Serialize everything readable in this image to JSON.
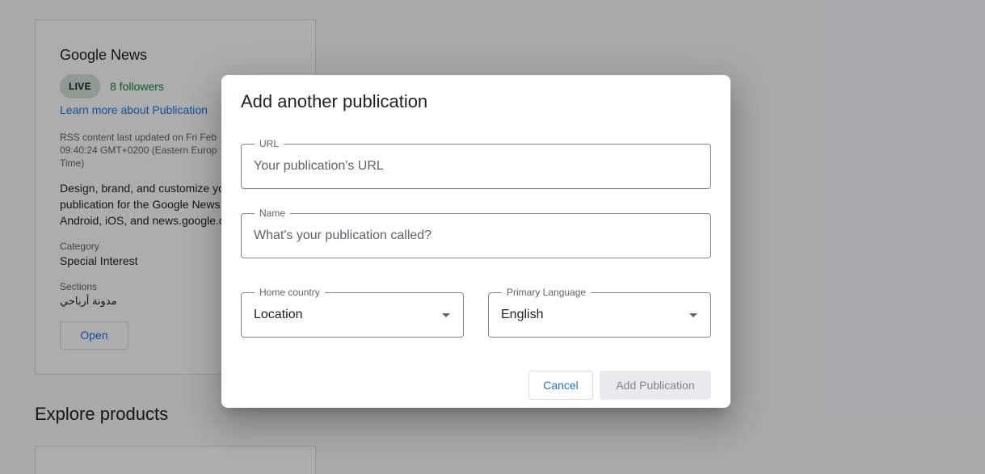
{
  "background": {
    "card": {
      "title": "Google News",
      "status_badge": "LIVE",
      "followers": "8 followers",
      "learn_link": "Learn more about Publication",
      "rss_text": "RSS content last updated on Fri Feb 09:40:24 GMT+0200 (Eastern Europ Time)",
      "description": "Design, brand, and customize yo publication for the Google News Android, iOS, and news.google.c",
      "category_label": "Category",
      "category_value": "Special Interest",
      "sections_label": "Sections",
      "sections_value": "مدونة أرباحي",
      "open_button": "Open"
    },
    "explore_heading": "Explore products"
  },
  "dialog": {
    "title": "Add another publication",
    "url_field": {
      "label": "URL",
      "placeholder": "Your publication's URL",
      "value": ""
    },
    "name_field": {
      "label": "Name",
      "placeholder": "What's your publication called?",
      "value": ""
    },
    "home_country": {
      "label": "Home country",
      "value": "Location"
    },
    "primary_language": {
      "label": "Primary Language",
      "value": "English"
    },
    "cancel_button": "Cancel",
    "add_button": "Add Publication"
  }
}
